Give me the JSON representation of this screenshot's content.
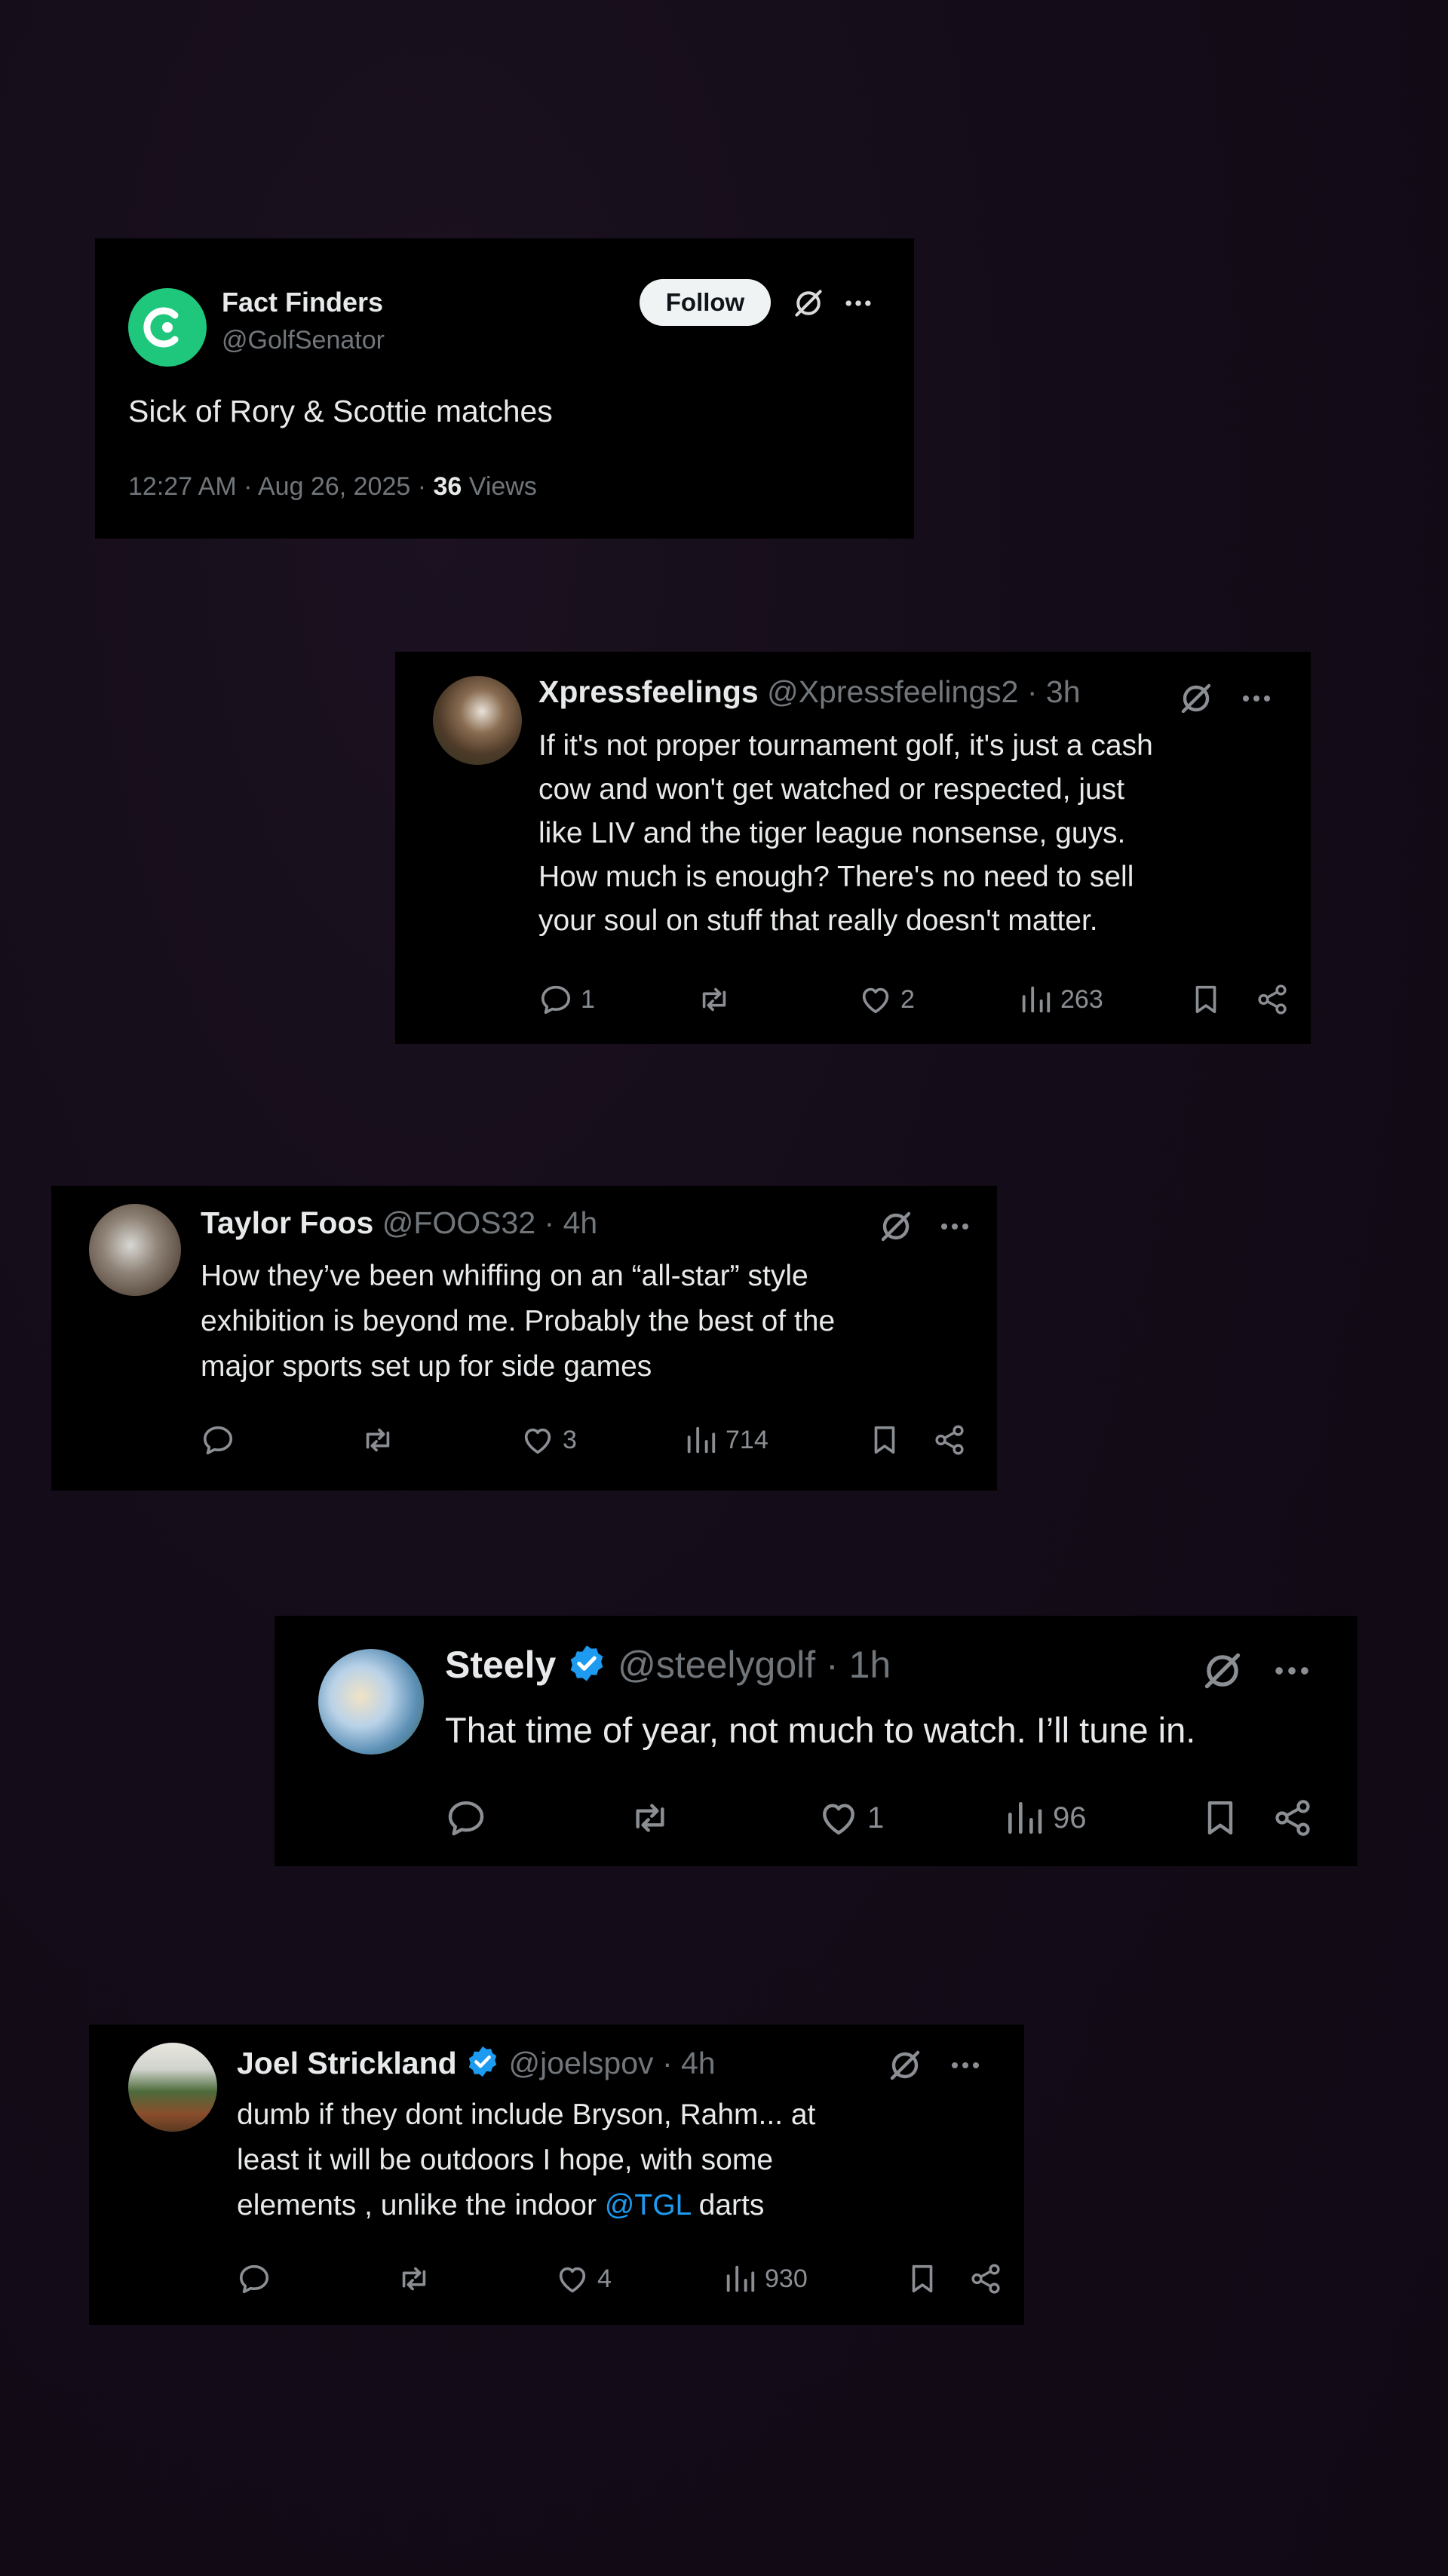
{
  "colors": {
    "accent": "#1d9bf0",
    "muted": "#71767b",
    "card": "#000000",
    "background": "#140c18",
    "follow_bg": "#eff3f4"
  },
  "main_post": {
    "name": "Fact Finders",
    "handle": "@GolfSenator",
    "follow_label": "Follow",
    "text": "Sick of Rory & Scottie matches",
    "timestamp": "12:27 AM · Aug 26, 2025 · ",
    "views_count": "36",
    "views_label": " Views"
  },
  "replies": [
    {
      "name": "Xpressfeelings",
      "handle": "@Xpressfeelings2",
      "time": "· 3h",
      "lines": [
        "If it's not proper tournament golf, it's just a cash",
        "cow and won't get watched or respected, just",
        "like LIV and the tiger league nonsense,  guys.",
        "How much is enough? There's no need to sell",
        "your soul on stuff that really doesn't matter."
      ],
      "replies_count": "1",
      "reposts_count": "",
      "likes_count": "2",
      "views_count": "263",
      "verified": false
    },
    {
      "name": "Taylor Foos",
      "handle": "@FOOS32",
      "time": "· 4h",
      "lines": [
        "How they’ve been whiffing on an “all-star” style",
        "exhibition is beyond me. Probably the best of the",
        "major sports set up for side games"
      ],
      "replies_count": "",
      "reposts_count": "",
      "likes_count": "3",
      "views_count": "714",
      "verified": false
    },
    {
      "name": "Steely",
      "handle": "@steelygolf",
      "time": "· 1h",
      "lines": [
        "That time of year, not much to watch. I’ll tune in."
      ],
      "replies_count": "",
      "reposts_count": "",
      "likes_count": "1",
      "views_count": "96",
      "verified": true
    },
    {
      "name": "Joel Strickland",
      "handle": "@joelspov",
      "time": "· 4h",
      "line1": "dumb if they dont include Bryson, Rahm... at",
      "line2": "least it will be outdoors I hope, with some",
      "line3_pre": "elements , unlike the indoor ",
      "line3_mention": "@TGL",
      "line3_post": " darts",
      "replies_count": "",
      "reposts_count": "",
      "likes_count": "4",
      "views_count": "930",
      "verified": true
    }
  ],
  "icons": [
    "grok-icon",
    "more-icon",
    "reply-icon",
    "repost-icon",
    "like-icon",
    "views-icon",
    "bookmark-icon",
    "share-icon",
    "verified-icon"
  ]
}
